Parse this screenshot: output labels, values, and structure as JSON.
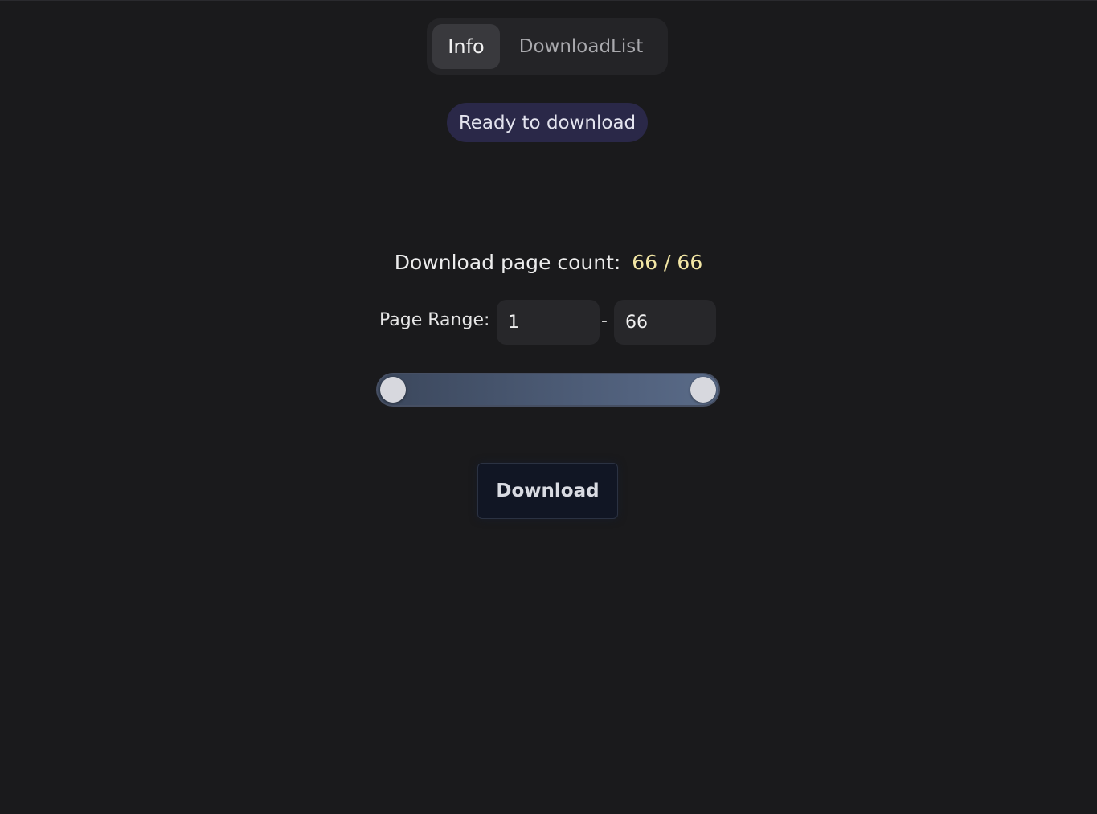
{
  "tabs": [
    {
      "label": "Info",
      "active": true
    },
    {
      "label": "DownloadList",
      "active": false
    }
  ],
  "status": {
    "text": "Ready to download",
    "color": "#2a2848"
  },
  "page_count": {
    "label": "Download page count:",
    "value": "66 / 66",
    "selected": 66,
    "total": 66,
    "value_color": "#f3e7a5"
  },
  "page_range": {
    "label": "Page Range:",
    "from": "1",
    "to": "66",
    "separator": "-",
    "min": 1,
    "max": 66
  },
  "download_button": {
    "label": "Download"
  }
}
